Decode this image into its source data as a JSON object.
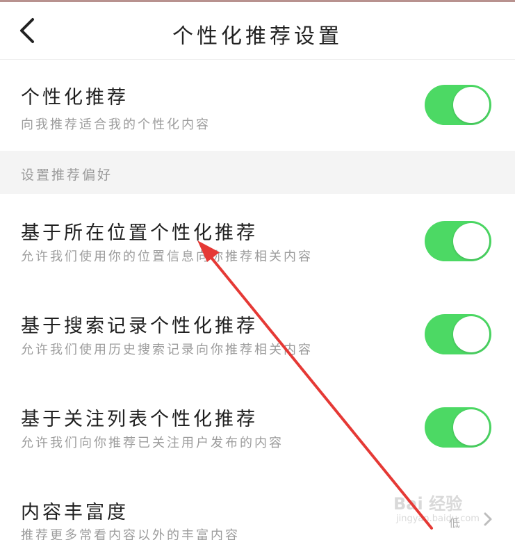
{
  "nav": {
    "title": "个性化推荐设置",
    "back_icon": "chevron-left-icon"
  },
  "rows": [
    {
      "title": "个性化推荐",
      "subtitle": "向我推荐适合我的个性化内容",
      "enabled": true
    },
    {
      "title": "基于所在位置个性化推荐",
      "subtitle": "允许我们使用你的位置信息向你推荐相关内容",
      "enabled": true
    },
    {
      "title": "基于搜索记录个性化推荐",
      "subtitle": "允许我们使用历史搜索记录向你推荐相关内容",
      "enabled": true
    },
    {
      "title": "基于关注列表个性化推荐",
      "subtitle": "允许我们向你推荐已关注用户发布的内容",
      "enabled": true
    },
    {
      "title": "内容丰富度",
      "subtitle": "推荐更多常看内容以外的丰富内容",
      "value": "低"
    }
  ],
  "section": {
    "label": "设置推荐偏好"
  },
  "watermark": {
    "text": "Bai 经验",
    "sub": "jingyan.baidu.com"
  },
  "colors": {
    "toggle_on": "#4cd964",
    "section_bg": "#f4f4f4",
    "annotation_arrow": "#e53935"
  }
}
